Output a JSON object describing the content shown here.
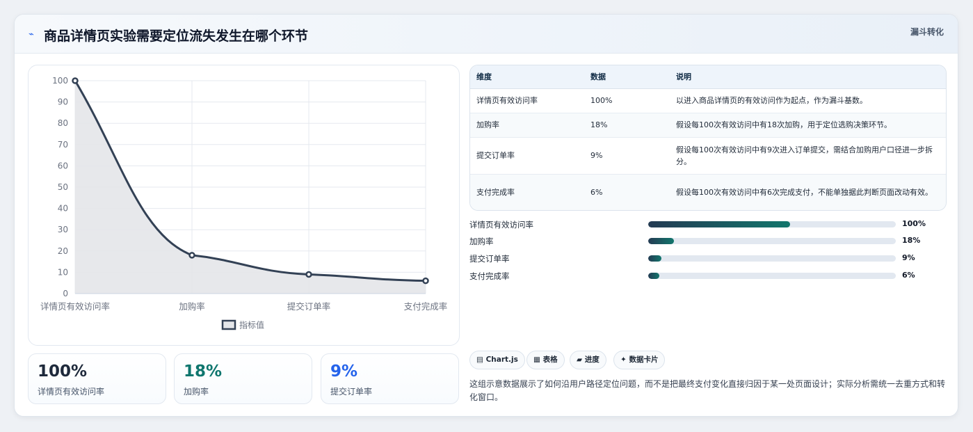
{
  "header": {
    "icon": "lightning-icon",
    "title": "商品详情页实验需要定位流失发生在哪个环节",
    "tag": "漏斗转化"
  },
  "chart_data": {
    "type": "line",
    "categories": [
      "详情页有效访问率",
      "加购率",
      "提交订单率",
      "支付完成率"
    ],
    "series": [
      {
        "name": "指标值",
        "values": [
          100,
          18,
          9,
          6
        ]
      }
    ],
    "ylim": [
      0,
      100
    ],
    "yticks": [
      0,
      10,
      20,
      30,
      40,
      50,
      60,
      70,
      80,
      90,
      100
    ],
    "fill": true,
    "smooth": true,
    "grid": true,
    "legend": "bottom",
    "colors": {
      "line": "#334155",
      "fill": "#e4e6e9",
      "grid": "#e5e9ef",
      "axis_text": "#6b7280"
    }
  },
  "stats": [
    {
      "value": "100%",
      "label": "详情页有效访问率",
      "color": "#1e293b"
    },
    {
      "value": "18%",
      "label": "加购率",
      "color": "#0f766e"
    },
    {
      "value": "9%",
      "label": "提交订单率",
      "color": "#2563eb"
    }
  ],
  "table": {
    "headers": [
      "维度",
      "数据",
      "说明"
    ],
    "rows": [
      [
        "详情页有效访问率",
        "100%",
        "以进入商品详情页的有效访问作为起点，作为漏斗基数。"
      ],
      [
        "加购率",
        "18%",
        "假设每100次有效访问中有18次加购，用于定位选购决策环节。"
      ],
      [
        "提交订单率",
        "9%",
        "假设每100次有效访问中有9次进入订单提交，需结合加购用户口径进一步拆分。"
      ],
      [
        "支付完成率",
        "6%",
        "假设每100次有效访问中有6次完成支付，不能单独据此判断页面改动有效。"
      ]
    ]
  },
  "progress": [
    {
      "label": "详情页有效访问率",
      "display": "100%",
      "fraction": 0.574
    },
    {
      "label": "加购率",
      "display": "18%",
      "fraction": 0.103
    },
    {
      "label": "提交订单率",
      "display": "9%",
      "fraction": 0.052
    },
    {
      "label": "支付完成率",
      "display": "6%",
      "fraction": 0.045
    }
  ],
  "chips": [
    {
      "icon": "chart-icon",
      "glyph": "▤",
      "label": "Chart.js"
    },
    {
      "icon": "table-icon",
      "glyph": "▦",
      "label": "表格"
    },
    {
      "icon": "progress-icon",
      "glyph": "▰",
      "label": "进度"
    },
    {
      "icon": "sparkle-icon",
      "glyph": "✦",
      "label": "数据卡片"
    }
  ],
  "note": "这组示意数据展示了如何沿用户路径定位问题，而不是把最终支付变化直接归因于某一处页面设计；实际分析需统一去重方式和转化窗口。"
}
